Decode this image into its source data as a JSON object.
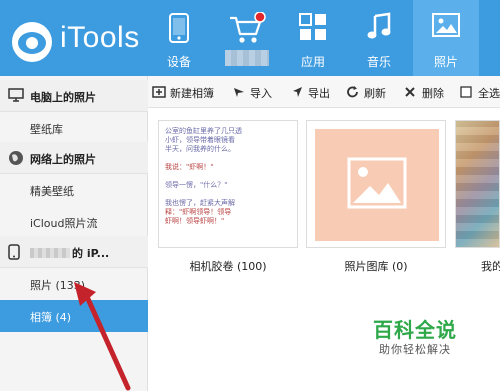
{
  "app": {
    "name": "iTools"
  },
  "nav": {
    "items": [
      {
        "label": "设备",
        "icon": "device-icon"
      },
      {
        "label": "",
        "icon": "shopping-cart-icon"
      },
      {
        "label": "应用",
        "icon": "apps-grid-icon"
      },
      {
        "label": "音乐",
        "icon": "music-note-icon"
      },
      {
        "label": "照片",
        "icon": "photo-icon",
        "active": true
      }
    ]
  },
  "sidebar": {
    "sections": [
      {
        "title": "电脑上的照片",
        "icon": "monitor-icon"
      },
      {
        "title": "网络上的照片",
        "icon": "globe-icon"
      },
      {
        "title": "的 iP...",
        "icon": "phone-icon"
      }
    ],
    "items": [
      {
        "label": "壁纸库"
      },
      {
        "label": "精美壁纸"
      },
      {
        "label": "iCloud照片流"
      },
      {
        "label": "照片 (133)"
      },
      {
        "label": "相簿 (4)",
        "active": true
      }
    ]
  },
  "toolbar": {
    "buttons": [
      {
        "label": "新建相簿",
        "icon": "new-album-icon"
      },
      {
        "label": "导入",
        "icon": "import-icon"
      },
      {
        "label": "导出",
        "icon": "export-icon"
      },
      {
        "label": "刷新",
        "icon": "refresh-icon"
      },
      {
        "label": "删除",
        "icon": "delete-icon"
      },
      {
        "label": "全选",
        "icon": "checkbox-icon"
      }
    ]
  },
  "albums": [
    {
      "label": "相机胶卷 (100)",
      "note_lines": [
        "公室的鱼缸里养了几只透",
        "小虾，领导带着眼镜看",
        "半天，问我养的什么。",
        "",
        "我说：\"虾啊！\"",
        "",
        "领导一愣，\"什么？\"",
        "",
        "我也愣了，赶紧大声解",
        "释：\"虾啊领导！领导",
        "虾啊！领导虾啊！\""
      ]
    },
    {
      "label": "照片图库 (0)"
    },
    {
      "label": "我的"
    }
  ],
  "watermark": {
    "main": "百科全说",
    "sub": "助你轻松解决"
  },
  "colors": {
    "header": "#3d9be0",
    "active": "#3d9be0",
    "arrow": "#c4232b",
    "watermark": "#2fa84a"
  }
}
